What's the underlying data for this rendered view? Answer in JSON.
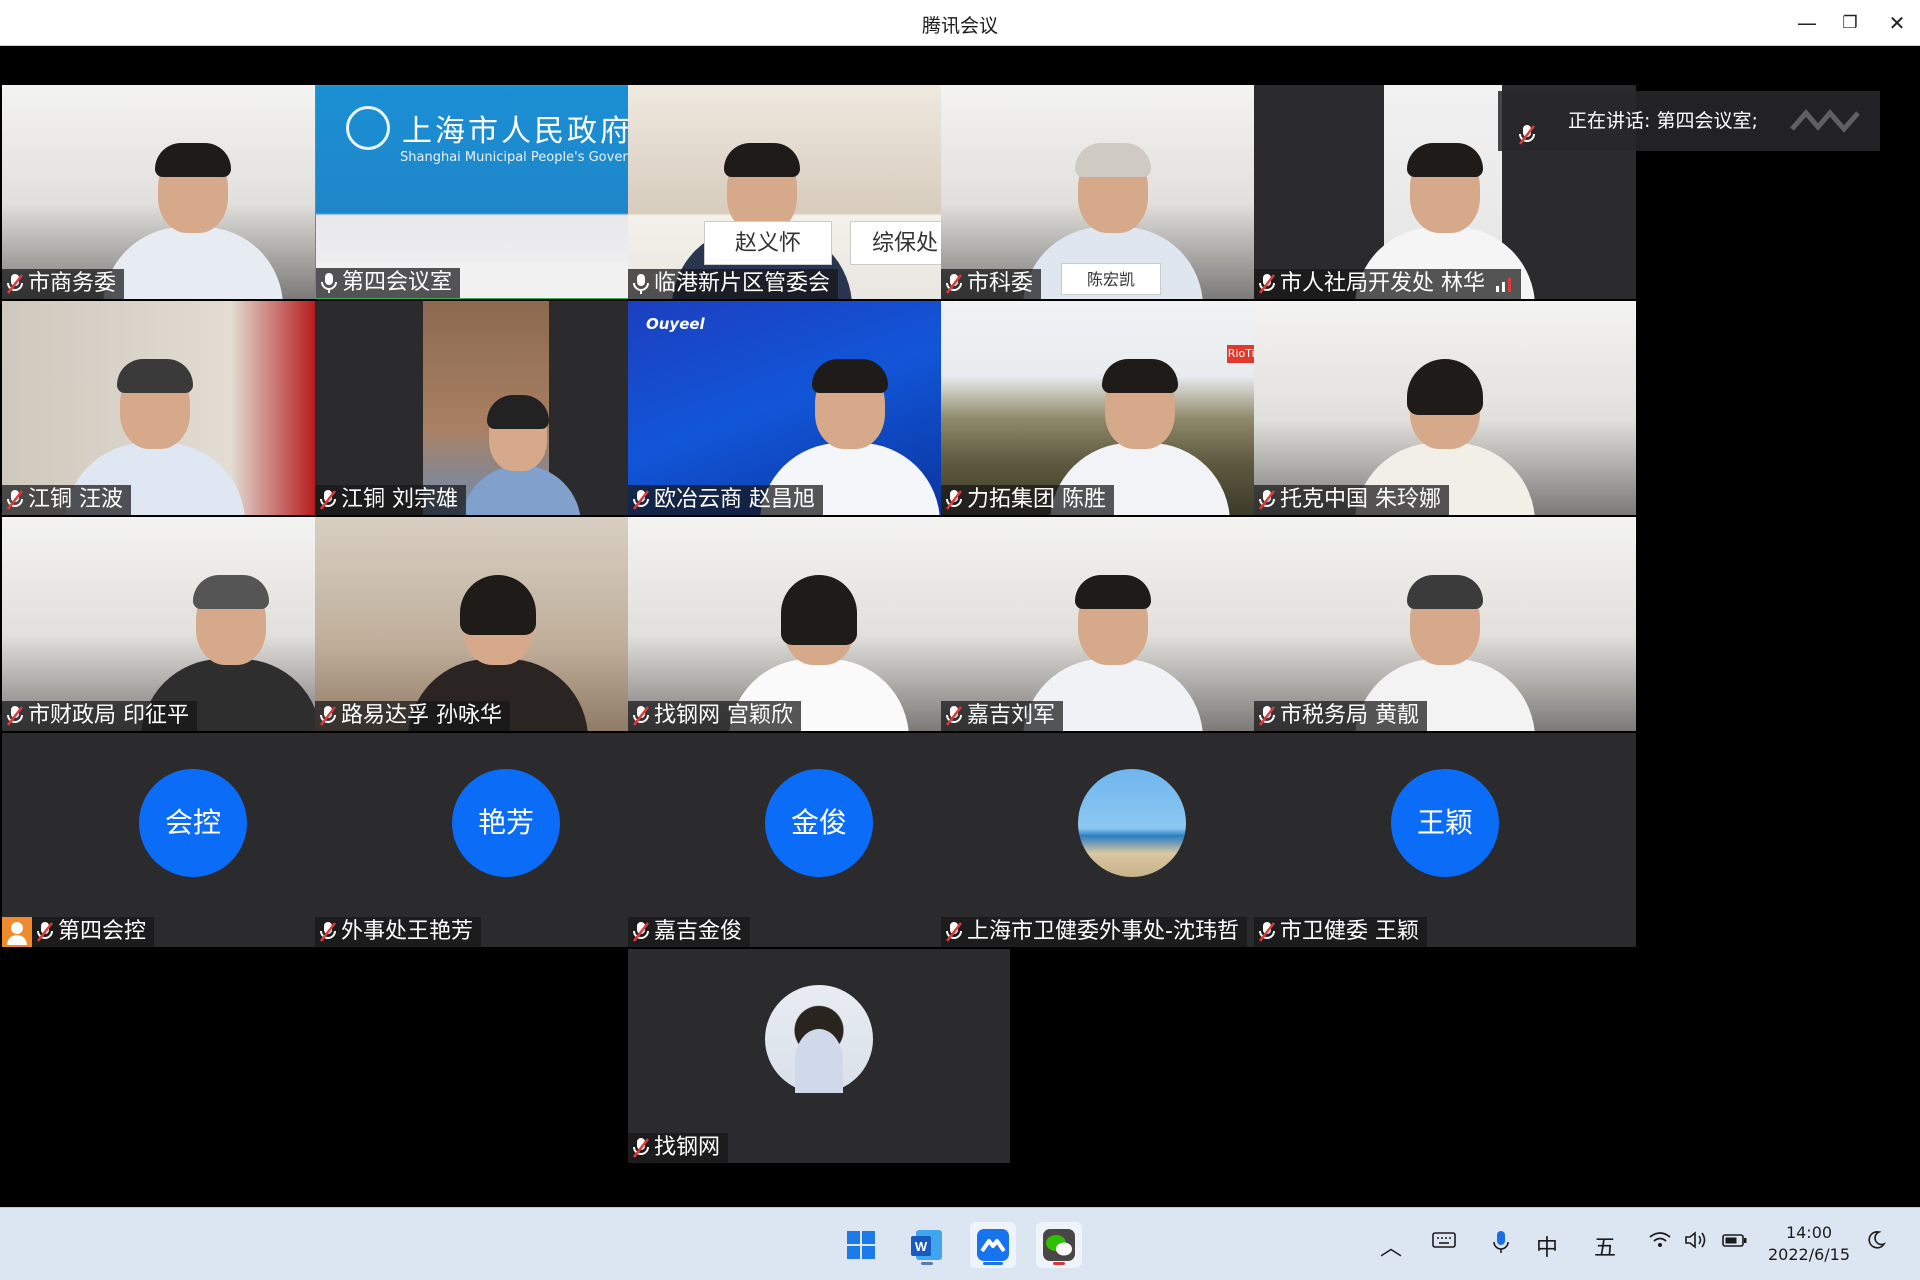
{
  "window": {
    "title": "腾讯会议",
    "minimize_icon": "minimize-icon",
    "maximize_icon": "restore-icon",
    "close_icon": "close-icon"
  },
  "speaking": {
    "text": "正在讲话: 第四会议室;"
  },
  "gov_banner": {
    "title": "上海市人民政府",
    "subtitle": "Shanghai Municipal People's Government"
  },
  "blue_tile": {
    "logo": "Ouyeel"
  },
  "placards": [
    "赵义怀",
    "综保处",
    "陈宏凯"
  ],
  "landscape_tag": "RioTinto 力拓",
  "participants": [
    {
      "name": "市商务委",
      "muted": true
    },
    {
      "name": "第四会议室",
      "muted": false
    },
    {
      "name": "临港新片区管委会",
      "muted": false
    },
    {
      "name": "市科委",
      "muted": true
    },
    {
      "name": "市人社局开发处 林华",
      "muted": true,
      "signal": true
    },
    {
      "name": "江铜 汪波",
      "muted": true
    },
    {
      "name": "江铜 刘宗雄",
      "muted": true
    },
    {
      "name": "欧冶云商 赵昌旭",
      "muted": true
    },
    {
      "name": "力拓集团 陈胜",
      "muted": true
    },
    {
      "name": "托克中国 朱玲娜",
      "muted": true
    },
    {
      "name": "市财政局 印征平",
      "muted": true
    },
    {
      "name": "路易达孚 孙咏华",
      "muted": true
    },
    {
      "name": "找钢网 宫颖欣",
      "muted": true
    },
    {
      "name": "嘉吉刘军",
      "muted": true
    },
    {
      "name": "市税务局 黄靓",
      "muted": true
    },
    {
      "name": "第四会控",
      "muted": true,
      "host": true,
      "avatar_text": "会控"
    },
    {
      "name": "外事处王艳芳",
      "muted": true,
      "avatar_text": "艳芳"
    },
    {
      "name": "嘉吉金俊",
      "muted": true,
      "avatar_text": "金俊"
    },
    {
      "name": "上海市卫健委外事处-沈玮哲",
      "muted": true,
      "avatar_photo": "sea"
    },
    {
      "name": "市卫健委 王颖",
      "muted": true,
      "avatar_text": "王颖"
    },
    {
      "name": "找钢网",
      "muted": true,
      "avatar_photo": "woman"
    }
  ],
  "taskbar": {
    "apps": [
      "windows-start",
      "word",
      "tencent-meeting",
      "wechat"
    ],
    "tray": {
      "chevron": "︿",
      "ime_lang": "中",
      "ime_mode": "五"
    },
    "clock": {
      "time": "14:00",
      "date": "2022/6/15"
    }
  },
  "colors": {
    "accent": "#0a6cf7",
    "host_badge": "#f08b2d",
    "muted_red": "#e0393a"
  }
}
